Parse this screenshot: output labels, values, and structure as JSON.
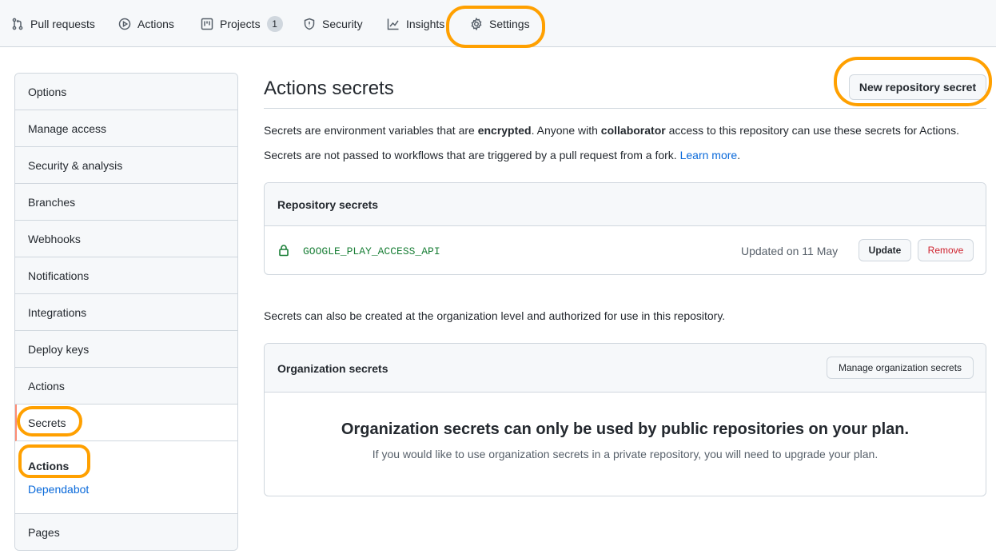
{
  "nav": {
    "pull_requests": "Pull requests",
    "actions": "Actions",
    "projects": "Projects",
    "projects_count": "1",
    "security": "Security",
    "insights": "Insights",
    "settings": "Settings"
  },
  "sidebar": {
    "items": [
      "Options",
      "Manage access",
      "Security & analysis",
      "Branches",
      "Webhooks",
      "Notifications",
      "Integrations",
      "Deploy keys",
      "Actions",
      "Secrets"
    ],
    "sub_active": "Actions",
    "sub_link": "Dependabot",
    "last_item": "Pages"
  },
  "main": {
    "title": "Actions secrets",
    "new_secret_button": "New repository secret",
    "desc1_a": "Secrets are environment variables that are ",
    "desc1_b": "encrypted",
    "desc1_c": ". Anyone with ",
    "desc1_d": "collaborator",
    "desc1_e": " access to this repository can use these secrets for Actions.",
    "desc2_a": "Secrets are not passed to workflows that are triggered by a pull request from a fork. ",
    "desc2_link": "Learn more",
    "desc2_end": ".",
    "repo_box_title": "Repository secrets",
    "secret_name": "GOOGLE_PLAY_ACCESS_API",
    "secret_updated": "Updated on 11 May",
    "update_button": "Update",
    "remove_button": "Remove",
    "org_note": "Secrets can also be created at the organization level and authorized for use in this repository.",
    "org_box_title": "Organization secrets",
    "manage_org_button": "Manage organization secrets",
    "org_empty_title": "Organization secrets can only be used by public repositories on your plan.",
    "org_empty_sub": "If you would like to use organization secrets in a private repository, you will need to upgrade your plan."
  },
  "colors": {
    "annotation": "#ffa000",
    "link": "#0969da",
    "secret_green": "#1a7f37",
    "danger": "#cf222e"
  }
}
